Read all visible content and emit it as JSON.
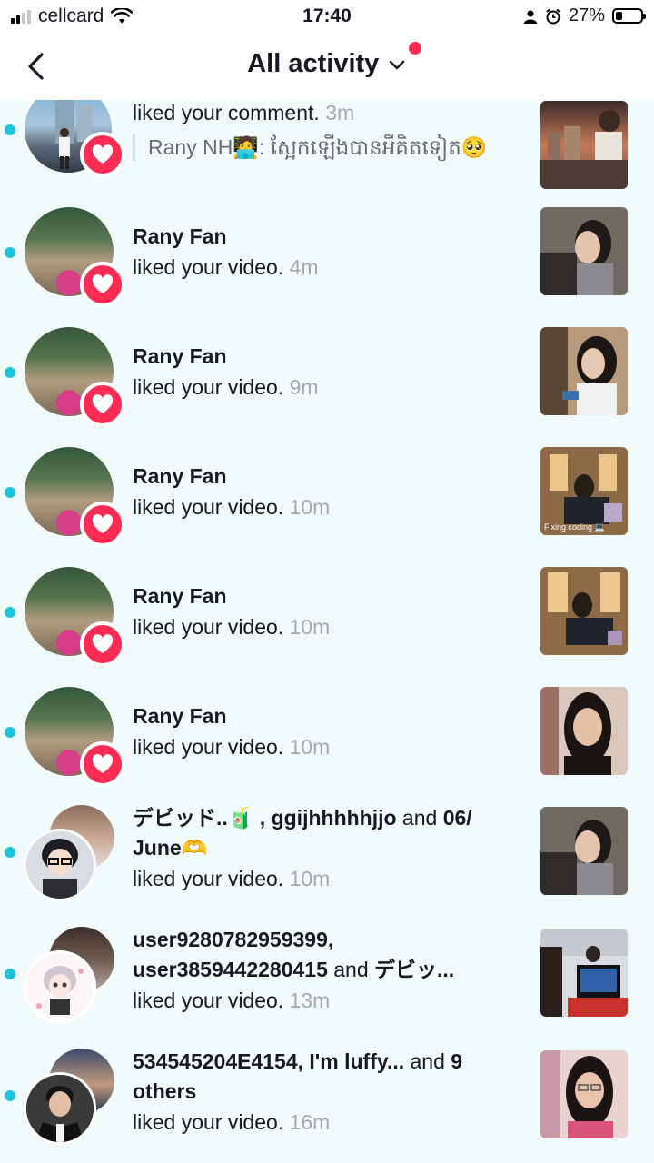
{
  "status_bar": {
    "carrier": "cellcard",
    "time": "17:40",
    "battery": "27%",
    "battery_level": 0.27
  },
  "header": {
    "title": "All activity"
  },
  "notifications": [
    {
      "name": "",
      "action": "liked your comment.",
      "time": "3m",
      "comment": "Rany NH🧑‍💻: ស្អែកឡើងបានអីគិតទៀត🥺"
    },
    {
      "name": "Rany Fan",
      "action": "liked your video.",
      "time": "4m"
    },
    {
      "name": "Rany Fan",
      "action": "liked your video.",
      "time": "9m"
    },
    {
      "name": "Rany Fan",
      "action": "liked your video.",
      "time": "10m",
      "thumb_caption": "Fixing coding 💻"
    },
    {
      "name": "Rany Fan",
      "action": "liked your video.",
      "time": "10m"
    },
    {
      "name": "Rany Fan",
      "action": "liked your video.",
      "time": "10m"
    },
    {
      "name_part1": "デビッド..🧃 , ggijhhhhhjjo",
      "name_conj": " and ",
      "name_part2": "06/ June🫶",
      "action": "liked your video.",
      "time": "10m"
    },
    {
      "name_part1": "user9280782959399, user3859442280415",
      "name_conj": " and ",
      "name_part2": "デビッ...",
      "action": "liked your video.",
      "time": "13m"
    },
    {
      "name_part1": "534545204E4154, I'm luffy...",
      "name_conj": " and ",
      "name_part2": "9 others",
      "action": "liked your video.",
      "time": "16m"
    }
  ],
  "icons": {
    "back": "chevron-left-icon",
    "dropdown": "chevron-down-icon",
    "badge": "heart-icon"
  },
  "colors": {
    "accent": "#fe2c55",
    "unread": "#20c3da",
    "background": "#f2fbfc"
  }
}
